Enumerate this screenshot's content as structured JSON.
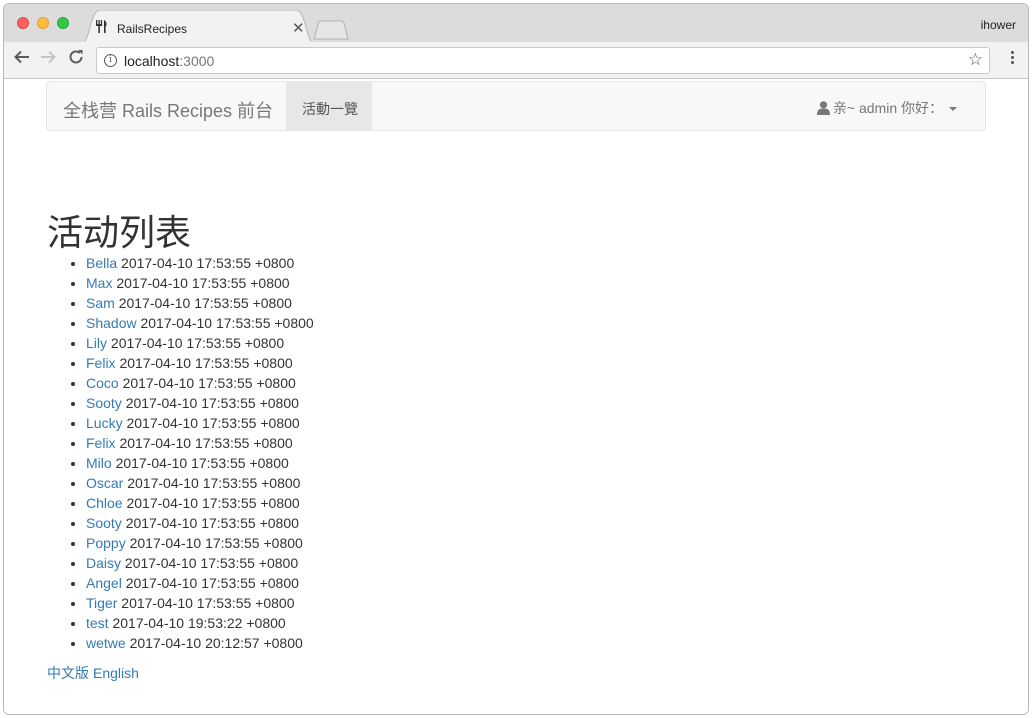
{
  "browser": {
    "tab_title": "RailsRecipes",
    "profile_name": "ihower",
    "url_host": "localhost",
    "url_port": ":3000"
  },
  "navbar": {
    "brand": "全栈营 Rails Recipes 前台",
    "active_link": "活動一覽",
    "user_greeting": "亲~ admin 你好："
  },
  "page": {
    "heading": "活动列表"
  },
  "events": [
    {
      "name": "Bella",
      "time": "2017-04-10 17:53:55 +0800"
    },
    {
      "name": "Max",
      "time": "2017-04-10 17:53:55 +0800"
    },
    {
      "name": "Sam",
      "time": "2017-04-10 17:53:55 +0800"
    },
    {
      "name": "Shadow",
      "time": "2017-04-10 17:53:55 +0800"
    },
    {
      "name": "Lily",
      "time": "2017-04-10 17:53:55 +0800"
    },
    {
      "name": "Felix",
      "time": "2017-04-10 17:53:55 +0800"
    },
    {
      "name": "Coco",
      "time": "2017-04-10 17:53:55 +0800"
    },
    {
      "name": "Sooty",
      "time": "2017-04-10 17:53:55 +0800"
    },
    {
      "name": "Lucky",
      "time": "2017-04-10 17:53:55 +0800"
    },
    {
      "name": "Felix",
      "time": "2017-04-10 17:53:55 +0800"
    },
    {
      "name": "Milo",
      "time": "2017-04-10 17:53:55 +0800"
    },
    {
      "name": "Oscar",
      "time": "2017-04-10 17:53:55 +0800"
    },
    {
      "name": "Chloe",
      "time": "2017-04-10 17:53:55 +0800"
    },
    {
      "name": "Sooty",
      "time": "2017-04-10 17:53:55 +0800"
    },
    {
      "name": "Poppy",
      "time": "2017-04-10 17:53:55 +0800"
    },
    {
      "name": "Daisy",
      "time": "2017-04-10 17:53:55 +0800"
    },
    {
      "name": "Angel",
      "time": "2017-04-10 17:53:55 +0800"
    },
    {
      "name": "Tiger",
      "time": "2017-04-10 17:53:55 +0800"
    },
    {
      "name": "test",
      "time": "2017-04-10 19:53:22 +0800"
    },
    {
      "name": "wetwe",
      "time": "2017-04-10 20:12:57 +0800"
    }
  ],
  "footer": {
    "locale_zh": "中文版",
    "locale_en": "English"
  },
  "colors": {
    "link": "#337ab7",
    "navbar_bg": "#f8f8f8",
    "active_nav_bg": "#e7e7e7"
  },
  "icons": [
    "restaurant-icon",
    "close-icon",
    "back-arrow-icon",
    "forward-arrow-icon",
    "reload-icon",
    "info-icon",
    "star-icon",
    "more-vert-icon",
    "user-icon",
    "caret-down-icon"
  ]
}
